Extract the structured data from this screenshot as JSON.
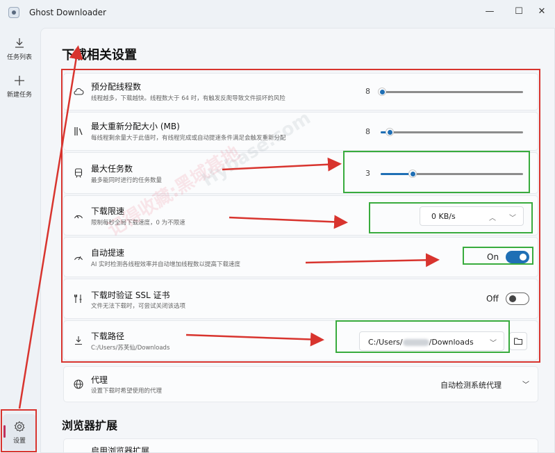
{
  "window": {
    "title": "Ghost Downloader",
    "minimize": "—",
    "maximize": "☐",
    "close": "✕"
  },
  "sidebar": {
    "items": [
      {
        "label": "任务列表",
        "icon": "download-icon"
      },
      {
        "label": "新建任务",
        "icon": "plus-icon"
      }
    ],
    "settings": {
      "label": "设置",
      "icon": "gear-icon"
    }
  },
  "sections": {
    "download": "下载相关设置",
    "browser": "浏览器扩展"
  },
  "settings": {
    "threads": {
      "title": "预分配线程数",
      "desc": "线程越多，下载越快。线程数大于 64 时，有触发反爬导致文件损坏的风险",
      "value": "8",
      "fraction": 0.0
    },
    "max_realloc": {
      "title": "最大重新分配大小 (MB)",
      "desc": "每线程剩余量大于此值时，有线程完成或自动提速条件满足会触发重新分配",
      "value": "8",
      "fraction": 0.06
    },
    "max_tasks": {
      "title": "最大任务数",
      "desc": "最多能同时进行的任务数量",
      "value": "3",
      "fraction": 0.22
    },
    "speed_limit": {
      "title": "下载限速",
      "desc": "限制每秒全局下载速度，0 为不限速",
      "value": "0 KB/s",
      "up": "︿",
      "down": "﹀"
    },
    "auto_speed": {
      "title": "自动提速",
      "desc": "AI 实时检测各线程效率并自动增加线程数以提高下载速度",
      "state": "On"
    },
    "ssl_verify": {
      "title": "下载时验证 SSL 证书",
      "desc": "文件无法下载时，可尝试关闭该选项",
      "state": "Off"
    },
    "download_path": {
      "title": "下载路径",
      "desc": "C:/Users/苏芙仙/Downloads",
      "value_prefix": "C:/Users/",
      "value_suffix": "/Downloads",
      "chevron": "﹀"
    },
    "proxy": {
      "title": "代理",
      "desc": "设置下载时希望使用的代理",
      "value": "自动检测系统代理",
      "chevron": "﹀"
    },
    "browser_ext": {
      "title": "启用浏览器扩展"
    }
  },
  "watermark": {
    "text1": "记得收藏:黑域基地",
    "text2": "Hybase.com"
  },
  "colors": {
    "accent": "#1f6fb5",
    "annotation_red": "#d8342e",
    "annotation_green": "#38ab3d"
  }
}
